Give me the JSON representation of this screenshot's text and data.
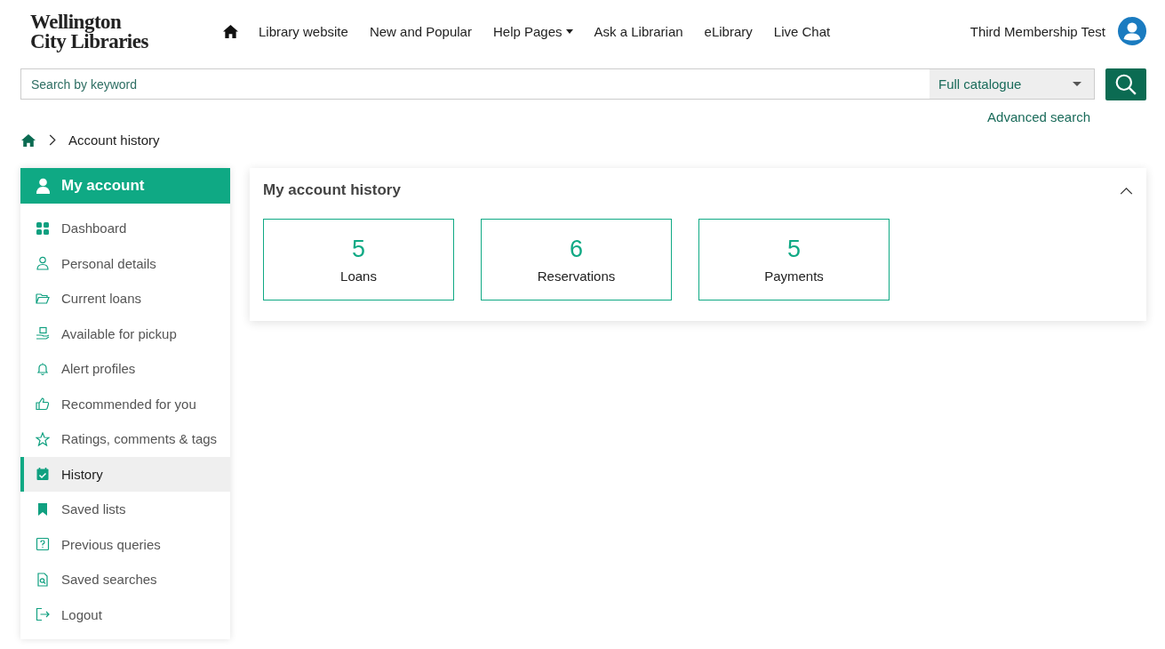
{
  "logo": {
    "line_1": "Wellington",
    "line_2": "City Libraries"
  },
  "nav": [
    {
      "label": "Library website",
      "has_menu": false
    },
    {
      "label": "New and Popular",
      "has_menu": false
    },
    {
      "label": "Help Pages",
      "has_menu": true
    },
    {
      "label": "Ask a Librarian",
      "has_menu": false
    },
    {
      "label": "eLibrary",
      "has_menu": false
    },
    {
      "label": "Live Chat",
      "has_menu": false
    }
  ],
  "user": {
    "name": "Third Membership Test"
  },
  "search": {
    "placeholder": "Search by keyword",
    "scope": "Full catalogue",
    "advanced_link": "Advanced search"
  },
  "breadcrumb": {
    "current": "Account history"
  },
  "sidebar": {
    "title": "My account",
    "items": [
      {
        "label": "Dashboard",
        "kind": "grid",
        "selected": false
      },
      {
        "label": "Personal details",
        "kind": "person",
        "selected": false
      },
      {
        "label": "Current loans",
        "kind": "folder",
        "selected": false
      },
      {
        "label": "Available for pickup",
        "kind": "pickup",
        "selected": false
      },
      {
        "label": "Alert profiles",
        "kind": "bell",
        "selected": false
      },
      {
        "label": "Recommended for you",
        "kind": "thumb",
        "selected": false
      },
      {
        "label": "Ratings, comments & tags",
        "kind": "star",
        "selected": false
      },
      {
        "label": "History",
        "kind": "calendar",
        "selected": true
      },
      {
        "label": "Saved lists",
        "kind": "bookmark",
        "selected": false
      },
      {
        "label": "Previous queries",
        "kind": "question",
        "selected": false
      },
      {
        "label": "Saved searches",
        "kind": "searchdoc",
        "selected": false
      },
      {
        "label": "Logout",
        "kind": "logout",
        "selected": false
      }
    ]
  },
  "panel": {
    "title": "My account history",
    "expanded": true,
    "stats": [
      {
        "count": "5",
        "label": "Loans"
      },
      {
        "count": "6",
        "label": "Reservations"
      },
      {
        "count": "5",
        "label": "Payments"
      }
    ]
  }
}
